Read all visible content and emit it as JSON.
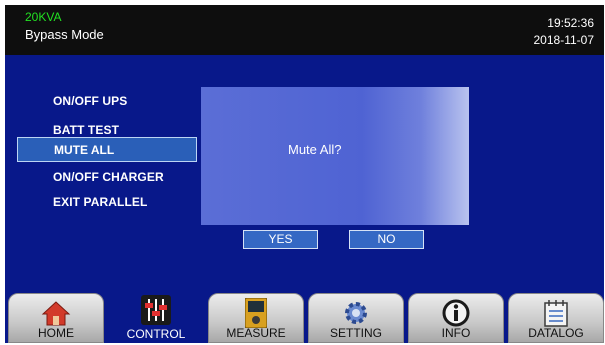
{
  "header": {
    "model": "20KVA",
    "mode": "Bypass Mode",
    "time": "19:52:36",
    "date": "2018-11-07"
  },
  "menu": {
    "items": [
      "ON/OFF UPS",
      "BATT TEST",
      "MUTE ALL",
      "ON/OFF CHARGER",
      "EXIT PARALLEL"
    ],
    "selected": "MUTE ALL"
  },
  "dialog": {
    "message": "Mute All?",
    "yes_label": "YES",
    "no_label": "NO"
  },
  "tabs": [
    {
      "label": "HOME",
      "icon": "home-icon"
    },
    {
      "label": "CONTROL",
      "icon": "control-sliders-icon",
      "active": true
    },
    {
      "label": "MEASURE",
      "icon": "meter-icon"
    },
    {
      "label": "SETTING",
      "icon": "gear-icon"
    },
    {
      "label": "INFO",
      "icon": "info-icon"
    },
    {
      "label": "DATALOG",
      "icon": "calendar-log-icon"
    }
  ],
  "colors": {
    "background": "#08188a",
    "header": "#0e0e0e",
    "model_text": "#22e022",
    "selection": "#2a5fb8"
  }
}
